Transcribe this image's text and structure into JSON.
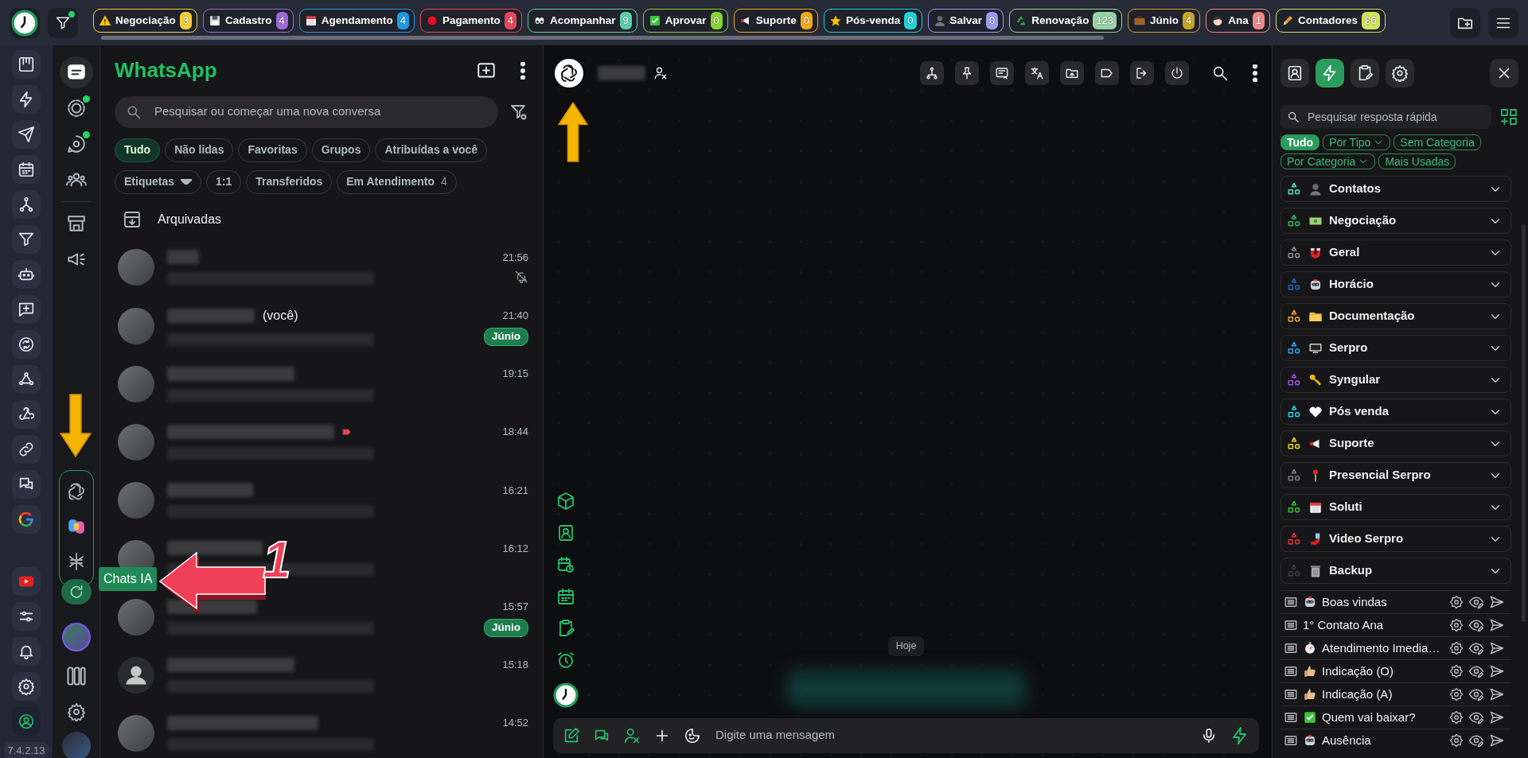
{
  "top_bar": {
    "tags": [
      {
        "label": "Negociação",
        "count": "3",
        "color": "#f2cf3a"
      },
      {
        "label": "Cadastro",
        "count": "4",
        "color": "#9b6ad6"
      },
      {
        "label": "Agendamento",
        "count": "4",
        "color": "#1e9be6"
      },
      {
        "label": "Pagamento",
        "count": "4",
        "color": "#e8475a"
      },
      {
        "label": "Acompanhar",
        "count": "9",
        "color": "#5ccfa8"
      },
      {
        "label": "Aprovar",
        "count": "0",
        "color": "#86d62e"
      },
      {
        "label": "Suporte",
        "count": "0",
        "color": "#f2a91c"
      },
      {
        "label": "Pós-venda",
        "count": "0",
        "color": "#1fd3d8"
      },
      {
        "label": "Salvar",
        "count": "0",
        "color": "#9a9cf0"
      },
      {
        "label": "Renovação",
        "count": "123",
        "color": "#97d3a4"
      },
      {
        "label": "Júnio",
        "count": "4",
        "color": "#c9a42a"
      },
      {
        "label": "Ana",
        "count": "1",
        "color": "#f08a8a"
      },
      {
        "label": "Contadores",
        "count": "86",
        "color": "#d4e35a"
      }
    ]
  },
  "version": "7.4.2.13",
  "nav": [
    {
      "selected": true,
      "dot": false
    },
    {
      "selected": false,
      "dot": true
    },
    {
      "selected": false,
      "dot": true
    },
    {
      "selected": false,
      "dot": false
    },
    {
      "selected": false,
      "dot": false
    },
    {
      "selected": false,
      "dot": false
    }
  ],
  "chat_list": {
    "title": "WhatsApp",
    "search": {
      "placeholder": "Pesquisar ou começar uma nova conversa"
    },
    "filters": [
      {
        "label": "Tudo",
        "selected": true,
        "kind": "chip"
      },
      {
        "label": "Não lidas",
        "selected": false,
        "kind": "chip"
      },
      {
        "label": "Favoritas",
        "selected": false,
        "kind": "chip"
      },
      {
        "label": "Grupos",
        "selected": false,
        "kind": "chip"
      },
      {
        "label": "Atribuídas a você",
        "selected": false,
        "kind": "chip"
      },
      {
        "label": "Etiquetas",
        "selected": false,
        "kind": "dropdown"
      },
      {
        "label": "1:1",
        "selected": false,
        "kind": "chip"
      },
      {
        "label": "Transferidos",
        "selected": false,
        "kind": "chip"
      },
      {
        "label": "Em Atendimento",
        "selected": false,
        "kind": "chip",
        "count": "4"
      }
    ],
    "archived": "Arquivadas",
    "chats": [
      {
        "time": "21:56",
        "kind": "photo",
        "muted": true,
        "tagged": false
      },
      {
        "time": "21:40",
        "kind": "photo",
        "suffix": "(você)",
        "label": "Júnio",
        "muted": false,
        "tagged": false
      },
      {
        "time": "19:15",
        "kind": "photo",
        "muted": false,
        "tagged": false
      },
      {
        "time": "18:44",
        "kind": "photo",
        "muted": false,
        "tagged": true
      },
      {
        "time": "16:21",
        "kind": "photo",
        "muted": false,
        "tagged": false
      },
      {
        "time": "16:12",
        "kind": "photo",
        "muted": false,
        "tagged": false
      },
      {
        "time": "15:57",
        "kind": "photo",
        "label": "Júnio",
        "muted": false,
        "tagged": false
      },
      {
        "time": "15:18",
        "kind": "default",
        "muted": false,
        "tagged": false
      },
      {
        "time": "14:52",
        "kind": "photo",
        "muted": false,
        "tagged": false
      }
    ]
  },
  "conversation": {
    "date": "Hoje",
    "composer": {
      "placeholder": "Digite uma mensagem"
    }
  },
  "quick_replies": {
    "tabs": [
      {
        "selected": false
      },
      {
        "selected": true
      },
      {
        "selected": false
      },
      {
        "selected": false
      }
    ],
    "search": {
      "placeholder": "Pesquisar resposta rápida"
    },
    "filters": [
      {
        "label": "Tudo",
        "selected": true,
        "dropdown": false
      },
      {
        "label": "Por Tipo",
        "selected": false,
        "dropdown": true
      },
      {
        "label": "Sem Categoria",
        "selected": false,
        "dropdown": false
      },
      {
        "label": "Por Categoria",
        "selected": false,
        "dropdown": true
      },
      {
        "label": "Mais Usadas",
        "selected": false,
        "dropdown": false
      }
    ],
    "categories": [
      {
        "name": "Contatos",
        "color": "#4fe0b0"
      },
      {
        "name": "Negociação",
        "color": "#2fb35f"
      },
      {
        "name": "Geral",
        "color": "#8a8a8a"
      },
      {
        "name": "Horácio",
        "color": "#2563b0"
      },
      {
        "name": "Documentação",
        "color": "#f0a030"
      },
      {
        "name": "Serpro",
        "color": "#2ea0f0"
      },
      {
        "name": "Syngular",
        "color": "#9a50e0"
      },
      {
        "name": "Pós venda",
        "color": "#20d0e0"
      },
      {
        "name": "Suporte",
        "color": "#f0d020"
      },
      {
        "name": "Presencial Serpro",
        "color": "#7a7a7a"
      },
      {
        "name": "Soluti",
        "color": "#30c030"
      },
      {
        "name": "Video Serpro",
        "color": "#e03040"
      },
      {
        "name": "Backup",
        "color": "#3c3c3c"
      }
    ],
    "replies": [
      {
        "title": "Boas vindas"
      },
      {
        "title": "1° Contato Ana"
      },
      {
        "title": "Atendimento Imedia…"
      },
      {
        "title": "Indicação (O)"
      },
      {
        "title": "Indicação (A)"
      },
      {
        "title": "Quem vai baixar?"
      },
      {
        "title": "Ausência"
      }
    ]
  },
  "annotation": {
    "tooltip": "Chats IA",
    "step": "1"
  }
}
